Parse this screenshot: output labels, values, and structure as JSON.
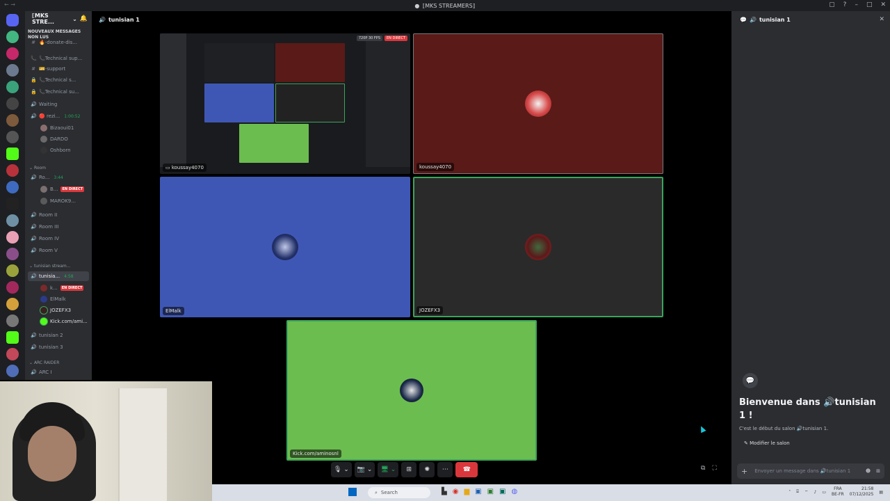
{
  "window": {
    "title": "⟦MKS STREAMERS⟧"
  },
  "server": {
    "name": "⟦MKS STRE...",
    "unread_banner": "NOUVEAUX MESSAGES NON LUS"
  },
  "channels": {
    "items": [
      {
        "label": "🔥-donate-dis...",
        "icon": "hash-icon"
      },
      {
        "label": "📞Technical sup...",
        "icon": "call-icon"
      },
      {
        "label": "🎫-support",
        "icon": "hash-icon"
      },
      {
        "label": "📞Technical s...",
        "icon": "lock-icon"
      },
      {
        "label": "📞Technical su...",
        "icon": "lock-icon"
      },
      {
        "label": "Waiting",
        "icon": "speaker-icon"
      },
      {
        "label": "🔴 rezi...",
        "icon": "speaker-icon",
        "time": "1:00:52"
      }
    ],
    "rezi_users": [
      "Bizaoui01",
      "DARDO",
      "Oshborn"
    ],
    "room_category": "Room",
    "room_channel": {
      "label": "Ro...",
      "time": "3:44"
    },
    "room_users": [
      {
        "name": "B...",
        "live": "EN DIRECT"
      },
      {
        "name": "MAROK9..."
      }
    ],
    "rooms": [
      "Room II",
      "Room III",
      "Room IV",
      "Room V"
    ],
    "tunisian_category": "tunisian stream...",
    "tunisian_active": {
      "label": "tunisia...",
      "time": "4:58"
    },
    "tunisian_users": [
      {
        "name": "k...",
        "live": "EN DIRECT"
      },
      {
        "name": "ElMalk"
      },
      {
        "name": "JOZEFX3"
      },
      {
        "name": "Kick.com/ami..."
      }
    ],
    "more": [
      "tunisian 2",
      "tunisian 3"
    ],
    "arc_category": "ARC RAIDER",
    "arc_channel": "ARC I"
  },
  "header": {
    "channel": "tunisian 1"
  },
  "tiles": [
    {
      "name": "koussay4070",
      "type": "screen-share",
      "badge_quality": "720P 30 FPS",
      "badge_live": "EN DIRECT"
    },
    {
      "name": "koussay4070",
      "bg": "#5a1a18"
    },
    {
      "name": "ElMalk",
      "bg": "#3f57b4"
    },
    {
      "name": "JOZEFX3",
      "bg": "#2a2a2a"
    },
    {
      "name": "Kick.com/aminosnl",
      "bg": "#6cbd4f"
    }
  ],
  "chat": {
    "title": "tunisian 1",
    "welcome_title": "Bienvenue dans 🔊tunisian 1 !",
    "welcome_sub": "C'est le début du salon 🔊tunisian 1.",
    "edit_label": "Modifier le salon",
    "input_placeholder": "Envoyer un message dans 🔊tunisian 1"
  },
  "taskbar": {
    "search_placeholder": "Search",
    "lang": "FRA",
    "lang_sub": "BE-FR",
    "time": "21:58",
    "date": "07/12/2025"
  },
  "colors": {
    "live_red": "#da373c",
    "speaking_green": "#3ba55c",
    "sidebar": "#2b2d31",
    "rail": "#1e1f22"
  }
}
